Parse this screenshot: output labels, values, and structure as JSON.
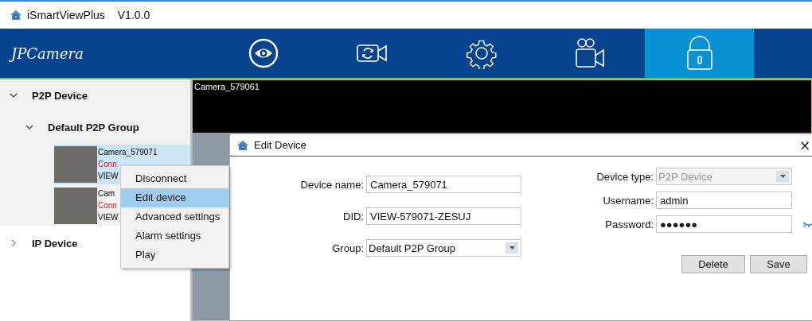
{
  "window": {
    "title": "iSmartViewPlus",
    "version": "V1.0.0"
  },
  "navbar": {
    "logo": "JPCamera",
    "tabs": [
      {
        "kind": "eye",
        "selected": false
      },
      {
        "kind": "camera-sync",
        "selected": false
      },
      {
        "kind": "gear",
        "selected": false
      },
      {
        "kind": "film-camera",
        "selected": false
      },
      {
        "kind": "lock",
        "selected": true
      }
    ]
  },
  "sidebar": {
    "groups": [
      {
        "label": "P2P Device",
        "expanded": true,
        "children": [
          {
            "label": "Default P2P Group",
            "expanded": true,
            "devices": [
              {
                "name": "Camera_579071",
                "status": "Conn",
                "did": "VIEW",
                "selected": true
              },
              {
                "name": "Cam",
                "status": "Conn",
                "did": "VIEW",
                "selected": false
              }
            ]
          }
        ]
      },
      {
        "label": "IP Device",
        "expanded": false
      }
    ]
  },
  "context_menu": {
    "items": [
      {
        "label": "Disconnect",
        "selected": false
      },
      {
        "label": "Edit device",
        "selected": true
      },
      {
        "label": "Advanced settings",
        "selected": false
      },
      {
        "label": "Alarm settings",
        "selected": false
      },
      {
        "label": "Play",
        "selected": false
      }
    ]
  },
  "video": {
    "title": "Camera_579061"
  },
  "dialog": {
    "title": "Edit Device",
    "close": "×",
    "left_fields": [
      {
        "label": "Device name:",
        "value": "Camera_579071",
        "kind": "text",
        "disabled": false
      },
      {
        "label": "DID:",
        "value": "VIEW-579071-ZESUJ",
        "kind": "text",
        "disabled": false
      },
      {
        "label": "Group:",
        "value": "Default P2P Group",
        "kind": "select",
        "disabled": false
      }
    ],
    "right_fields": [
      {
        "label": "Device type:",
        "value": "P2P Device",
        "kind": "select",
        "disabled": true
      },
      {
        "label": "Username:",
        "value": "admin",
        "kind": "text",
        "disabled": false
      },
      {
        "label": "Password:",
        "value": "●●●●●●",
        "kind": "password",
        "disabled": false
      }
    ],
    "buttons": [
      "Delete",
      "Save"
    ]
  }
}
